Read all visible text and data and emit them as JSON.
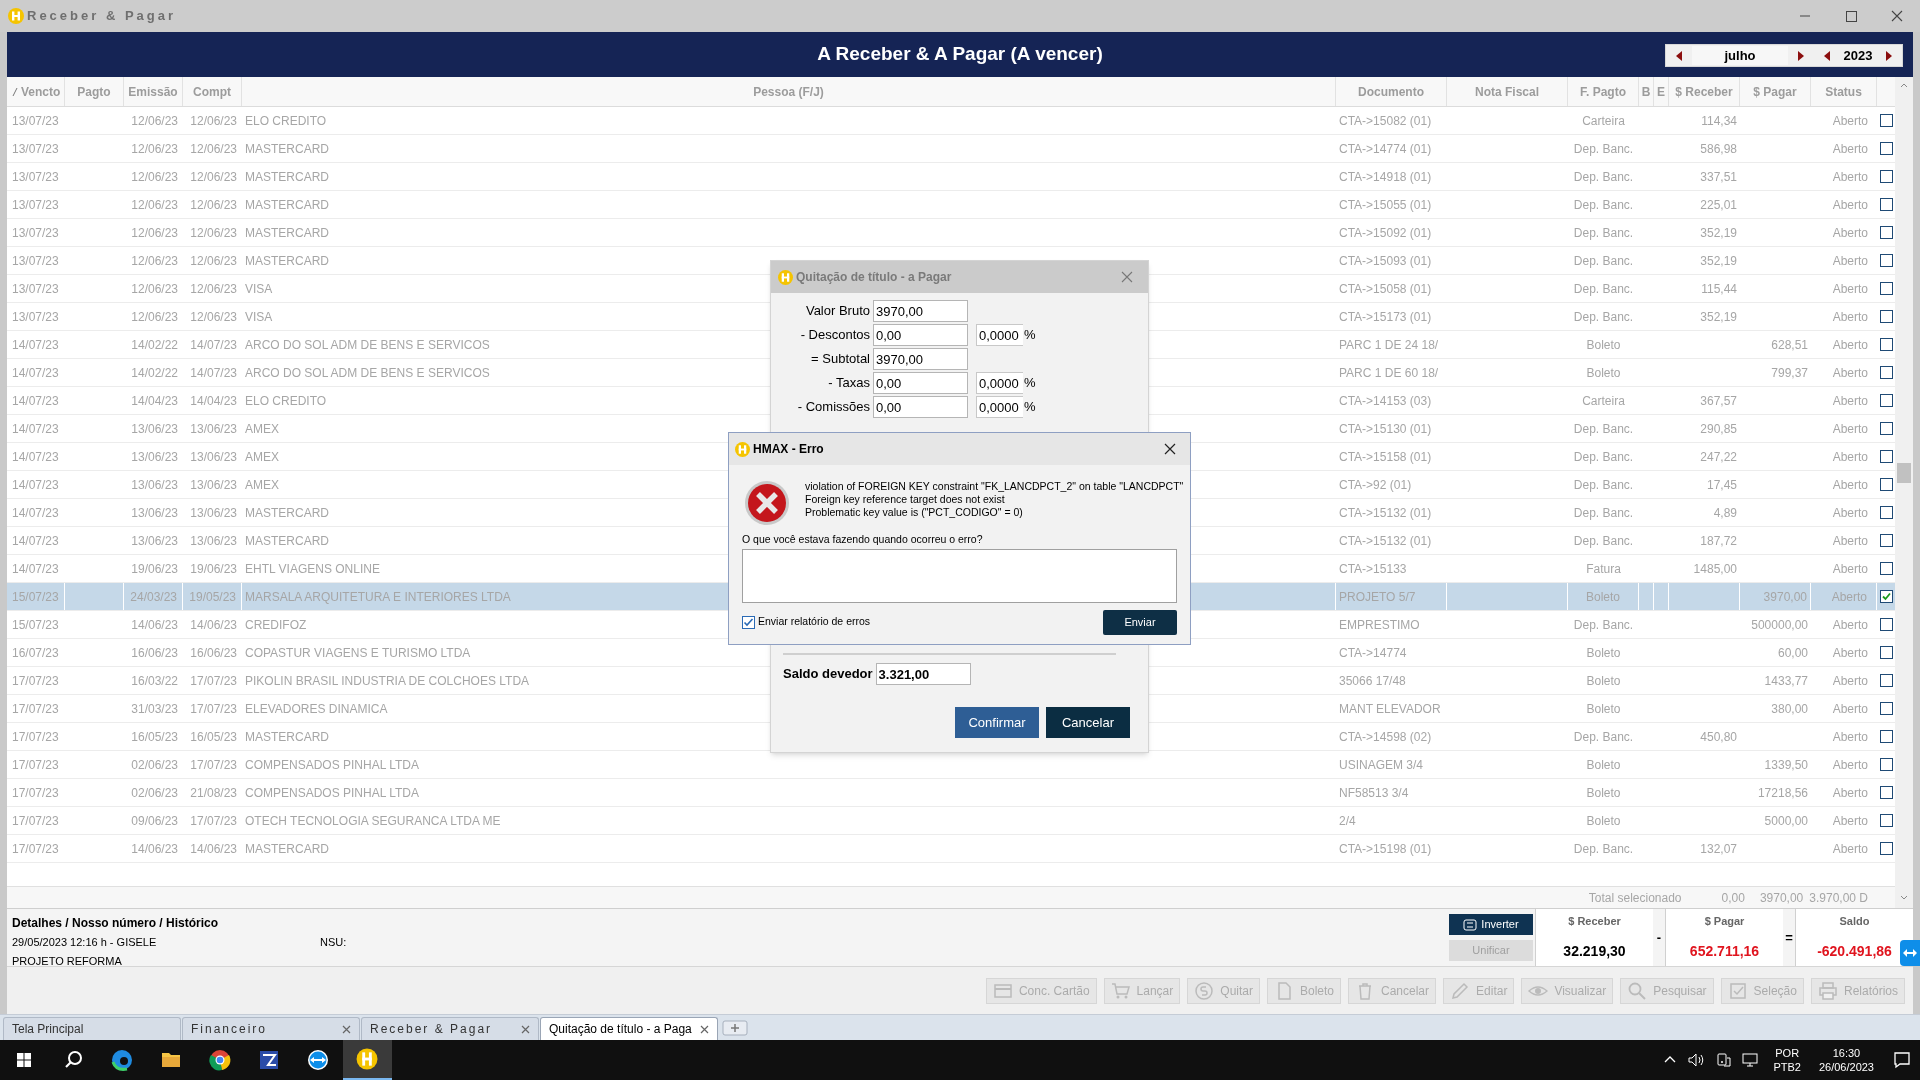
{
  "window": {
    "title": "Receber & Pagar"
  },
  "header": {
    "title": "A Receber & A Pagar (A vencer)",
    "month": "julho",
    "year": "2023"
  },
  "table": {
    "columns": [
      "Vencto",
      "Pagto",
      "Emissão",
      "Compt",
      "Pessoa (F/J)",
      "Documento",
      "Nota Fiscal",
      "F. Pagto",
      "B",
      "E",
      "$ Receber",
      "$ Pagar",
      "Status"
    ],
    "rows": [
      {
        "vencto": "13/07/23",
        "emissao": "12/06/23",
        "compt": "12/06/23",
        "pessoa": "ELO CREDITO",
        "documento": "CTA->15082 (01)",
        "f_pagto": "Carteira",
        "receber": "114,34",
        "status": "Aberto",
        "checked": false,
        "selected": false
      },
      {
        "vencto": "13/07/23",
        "emissao": "12/06/23",
        "compt": "12/06/23",
        "pessoa": "MASTERCARD",
        "documento": "CTA->14774 (01)",
        "f_pagto": "Dep. Banc.",
        "receber": "586,98",
        "status": "Aberto",
        "checked": false,
        "selected": false
      },
      {
        "vencto": "13/07/23",
        "emissao": "12/06/23",
        "compt": "12/06/23",
        "pessoa": "MASTERCARD",
        "documento": "CTA->14918 (01)",
        "f_pagto": "Dep. Banc.",
        "receber": "337,51",
        "status": "Aberto",
        "checked": false,
        "selected": false
      },
      {
        "vencto": "13/07/23",
        "emissao": "12/06/23",
        "compt": "12/06/23",
        "pessoa": "MASTERCARD",
        "documento": "CTA->15055 (01)",
        "f_pagto": "Dep. Banc.",
        "receber": "225,01",
        "status": "Aberto",
        "checked": false,
        "selected": false
      },
      {
        "vencto": "13/07/23",
        "emissao": "12/06/23",
        "compt": "12/06/23",
        "pessoa": "MASTERCARD",
        "documento": "CTA->15092 (01)",
        "f_pagto": "Dep. Banc.",
        "receber": "352,19",
        "status": "Aberto",
        "checked": false,
        "selected": false
      },
      {
        "vencto": "13/07/23",
        "emissao": "12/06/23",
        "compt": "12/06/23",
        "pessoa": "MASTERCARD",
        "documento": "CTA->15093 (01)",
        "f_pagto": "Dep. Banc.",
        "receber": "352,19",
        "status": "Aberto",
        "checked": false,
        "selected": false
      },
      {
        "vencto": "13/07/23",
        "emissao": "12/06/23",
        "compt": "12/06/23",
        "pessoa": "VISA",
        "documento": "CTA->15058 (01)",
        "f_pagto": "Dep. Banc.",
        "receber": "115,44",
        "status": "Aberto",
        "checked": false,
        "selected": false
      },
      {
        "vencto": "13/07/23",
        "emissao": "12/06/23",
        "compt": "12/06/23",
        "pessoa": "VISA",
        "documento": "CTA->15173 (01)",
        "f_pagto": "Dep. Banc.",
        "receber": "352,19",
        "status": "Aberto",
        "checked": false,
        "selected": false
      },
      {
        "vencto": "14/07/23",
        "emissao": "14/02/22",
        "compt": "14/07/23",
        "pessoa": "ARCO DO SOL ADM DE BENS E SERVICOS",
        "documento": "PARC 1 DE 24 18/",
        "f_pagto": "Boleto",
        "pagar": "628,51",
        "status": "Aberto",
        "checked": false,
        "selected": false
      },
      {
        "vencto": "14/07/23",
        "emissao": "14/02/22",
        "compt": "14/07/23",
        "pessoa": "ARCO DO SOL ADM DE BENS E SERVICOS",
        "documento": "PARC 1 DE 60 18/",
        "f_pagto": "Boleto",
        "pagar": "799,37",
        "status": "Aberto",
        "checked": false,
        "selected": false
      },
      {
        "vencto": "14/07/23",
        "emissao": "14/04/23",
        "compt": "14/04/23",
        "pessoa": "ELO CREDITO",
        "documento": "CTA->14153 (03)",
        "f_pagto": "Carteira",
        "receber": "367,57",
        "status": "Aberto",
        "checked": false,
        "selected": false
      },
      {
        "vencto": "14/07/23",
        "emissao": "13/06/23",
        "compt": "13/06/23",
        "pessoa": "AMEX",
        "documento": "CTA->15130 (01)",
        "f_pagto": "Dep. Banc.",
        "receber": "290,85",
        "status": "Aberto",
        "checked": false,
        "selected": false
      },
      {
        "vencto": "14/07/23",
        "emissao": "13/06/23",
        "compt": "13/06/23",
        "pessoa": "AMEX",
        "documento": "CTA->15158 (01)",
        "f_pagto": "Dep. Banc.",
        "receber": "247,22",
        "status": "Aberto",
        "checked": false,
        "selected": false
      },
      {
        "vencto": "14/07/23",
        "emissao": "13/06/23",
        "compt": "13/06/23",
        "pessoa": "AMEX",
        "documento": "CTA->92 (01)",
        "f_pagto": "Dep. Banc.",
        "receber": "17,45",
        "status": "Aberto",
        "checked": false,
        "selected": false
      },
      {
        "vencto": "14/07/23",
        "emissao": "13/06/23",
        "compt": "13/06/23",
        "pessoa": "MASTERCARD",
        "documento": "CTA->15132 (01)",
        "f_pagto": "Dep. Banc.",
        "receber": "4,89",
        "status": "Aberto",
        "checked": false,
        "selected": false
      },
      {
        "vencto": "14/07/23",
        "emissao": "13/06/23",
        "compt": "13/06/23",
        "pessoa": "MASTERCARD",
        "documento": "CTA->15132 (01)",
        "f_pagto": "Dep. Banc.",
        "receber": "187,72",
        "status": "Aberto",
        "checked": false,
        "selected": false
      },
      {
        "vencto": "14/07/23",
        "emissao": "19/06/23",
        "compt": "19/06/23",
        "pessoa": "EHTL VIAGENS ONLINE",
        "documento": "CTA->15133",
        "f_pagto": "Fatura",
        "receber": "1485,00",
        "status": "Aberto",
        "checked": false,
        "selected": false
      },
      {
        "vencto": "15/07/23",
        "emissao": "24/03/23",
        "compt": "19/05/23",
        "pessoa": "MARSALA ARQUITETURA E INTERIORES LTDA",
        "documento": "PROJETO 5/7",
        "f_pagto": "Boleto",
        "pagar": "3970,00",
        "status": "Aberto",
        "checked": true,
        "selected": true
      },
      {
        "vencto": "15/07/23",
        "emissao": "14/06/23",
        "compt": "14/06/23",
        "pessoa": "CREDIFOZ",
        "documento": "EMPRESTIMO",
        "f_pagto": "Dep. Banc.",
        "pagar": "500000,00",
        "status": "Aberto",
        "checked": false,
        "selected": false
      },
      {
        "vencto": "16/07/23",
        "emissao": "16/06/23",
        "compt": "16/06/23",
        "pessoa": "COPASTUR VIAGENS E TURISMO LTDA",
        "documento": "CTA->14774",
        "f_pagto": "Boleto",
        "pagar": "60,00",
        "status": "Aberto",
        "checked": false,
        "selected": false
      },
      {
        "vencto": "17/07/23",
        "emissao": "16/03/22",
        "compt": "17/07/23",
        "pessoa": "PIKOLIN BRASIL INDUSTRIA DE COLCHOES LTDA",
        "documento": "35066 17/48",
        "f_pagto": "Boleto",
        "pagar": "1433,77",
        "status": "Aberto",
        "checked": false,
        "selected": false
      },
      {
        "vencto": "17/07/23",
        "emissao": "31/03/23",
        "compt": "17/07/23",
        "pessoa": "ELEVADORES DINAMICA",
        "documento": "MANT ELEVADOR",
        "f_pagto": "Boleto",
        "pagar": "380,00",
        "status": "Aberto",
        "checked": false,
        "selected": false
      },
      {
        "vencto": "17/07/23",
        "emissao": "16/05/23",
        "compt": "16/05/23",
        "pessoa": "MASTERCARD",
        "documento": "CTA->14598 (02)",
        "f_pagto": "Dep. Banc.",
        "receber": "450,80",
        "status": "Aberto",
        "checked": false,
        "selected": false
      },
      {
        "vencto": "17/07/23",
        "emissao": "02/06/23",
        "compt": "17/07/23",
        "pessoa": "COMPENSADOS PINHAL LTDA",
        "documento": "USINAGEM 3/4",
        "f_pagto": "Boleto",
        "pagar": "1339,50",
        "status": "Aberto",
        "checked": false,
        "selected": false
      },
      {
        "vencto": "17/07/23",
        "emissao": "02/06/23",
        "compt": "21/08/23",
        "pessoa": "COMPENSADOS PINHAL LTDA",
        "documento": "NF58513 3/4",
        "f_pagto": "Boleto",
        "pagar": "17218,56",
        "status": "Aberto",
        "checked": false,
        "selected": false
      },
      {
        "vencto": "17/07/23",
        "emissao": "09/06/23",
        "compt": "17/07/23",
        "pessoa": "OTECH TECNOLOGIA SEGURANCA LTDA ME",
        "documento": "2/4",
        "f_pagto": "Boleto",
        "pagar": "5000,00",
        "status": "Aberto",
        "checked": false,
        "selected": false
      },
      {
        "vencto": "17/07/23",
        "emissao": "14/06/23",
        "compt": "14/06/23",
        "pessoa": "MASTERCARD",
        "documento": "CTA->15198 (01)",
        "f_pagto": "Dep. Banc.",
        "receber": "132,07",
        "status": "Aberto",
        "checked": false,
        "selected": false
      }
    ]
  },
  "totals": {
    "label": "Total selecionado",
    "receber": "0,00",
    "pagar": "3970,00",
    "saldo": "3.970,00 D"
  },
  "details": {
    "title": "Detalhes / Nosso número / Histórico",
    "line": "29/05/2023 12:16 h - GISELE",
    "nsu": "NSU:",
    "history": "PROJETO REFORMA"
  },
  "actions": [
    {
      "label": "Inverter",
      "disabled": false
    },
    {
      "label": "Unificar",
      "disabled": true
    }
  ],
  "summary": {
    "receber_label": "$ Receber",
    "receber": "32.219,30",
    "minus": "-",
    "pagar_label": "$ Pagar",
    "pagar": "652.711,16",
    "equals": "=",
    "saldo_label": "Saldo",
    "saldo": "-620.491,86"
  },
  "toolbar": [
    {
      "label": "Conc. Cartão",
      "disabled": true
    },
    {
      "label": "Lançar",
      "disabled": true
    },
    {
      "label": "Quitar",
      "disabled": true
    },
    {
      "label": "Boleto",
      "disabled": true
    },
    {
      "label": "Cancelar",
      "disabled": true
    },
    {
      "label": "Editar",
      "disabled": true
    },
    {
      "label": "Visualizar",
      "disabled": true
    },
    {
      "label": "Pesquisar",
      "disabled": true
    },
    {
      "label": "Seleção",
      "disabled": true
    },
    {
      "label": "Relatórios",
      "disabled": true
    }
  ],
  "tabs": [
    {
      "label": "Tela Principal",
      "selected": false,
      "closable": false,
      "spaced": false
    },
    {
      "label": "Financeiro",
      "selected": false,
      "closable": true,
      "spaced": true
    },
    {
      "label": "Receber & Pagar",
      "selected": false,
      "closable": true,
      "spaced": true
    },
    {
      "label": "Quitação de título - a Paga",
      "selected": true,
      "closable": true,
      "spaced": false
    }
  ],
  "payment_dialog": {
    "title": "Quitação de título - a Pagar",
    "fields": [
      {
        "label": "Valor Bruto",
        "value": "3970,00"
      },
      {
        "label": "- Descontos",
        "value": "0,00",
        "percent": "0,0000",
        "unit": "%"
      },
      {
        "label": "= Subtotal",
        "value": "3970,00"
      },
      {
        "label": "- Taxas",
        "value": "0,00",
        "percent": "0,0000",
        "unit": "%"
      },
      {
        "label": "- Comissões",
        "value": "0,00",
        "percent": "0,0000",
        "unit": "%"
      }
    ],
    "balance_label": "Saldo devedor",
    "balance": "3.321,00",
    "buttons": [
      "Confirmar",
      "Cancelar"
    ]
  },
  "error_dialog": {
    "title": "HMAX - Erro",
    "message": [
      "violation of FOREIGN KEY constraint \"FK_LANCDPCT_2\" on table \"LANCDPCT\"",
      "Foreign key reference target does not exist",
      "Problematic key value is (\"PCT_CODIGO\" = 0)"
    ],
    "question": "O que você estava fazendo quando ocorreu o erro?",
    "send_report": {
      "label": "Enviar relatório de erros",
      "checked": true
    },
    "button": "Enviar"
  },
  "taskbar": {
    "language": "POR",
    "layout": "PTB2",
    "time": "16:30",
    "date": "26/06/2023"
  }
}
